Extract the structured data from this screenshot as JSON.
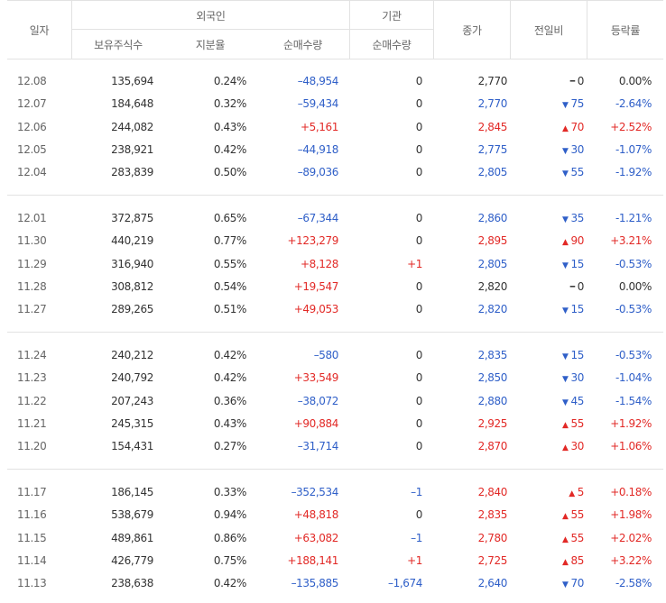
{
  "header": {
    "date": "일자",
    "foreign": "외국인",
    "holdings": "보유주식수",
    "ratio": "지분율",
    "foreign_net": "순매수량",
    "institution": "기관",
    "inst_net": "순매수량",
    "close": "종가",
    "diff": "전일비",
    "rate": "등락률"
  },
  "colors": {
    "up": "#e22926",
    "down": "#2f5fc8",
    "flat": "#333333"
  },
  "groups": [
    {
      "rows": [
        {
          "date": "12.08",
          "holdings": "135,694",
          "ratio": "0.24%",
          "foreign_net": "–48,954",
          "fdir": "down",
          "inst_net": "0",
          "idir": "flat",
          "close": "2,770",
          "cdir": "flat",
          "diff": "0",
          "ddir": "flat",
          "rate": "0.00%"
        },
        {
          "date": "12.07",
          "holdings": "184,648",
          "ratio": "0.32%",
          "foreign_net": "–59,434",
          "fdir": "down",
          "inst_net": "0",
          "idir": "flat",
          "close": "2,770",
          "cdir": "down",
          "diff": "75",
          "ddir": "down",
          "rate": "-2.64%"
        },
        {
          "date": "12.06",
          "holdings": "244,082",
          "ratio": "0.43%",
          "foreign_net": "+5,161",
          "fdir": "up",
          "inst_net": "0",
          "idir": "flat",
          "close": "2,845",
          "cdir": "up",
          "diff": "70",
          "ddir": "up",
          "rate": "+2.52%"
        },
        {
          "date": "12.05",
          "holdings": "238,921",
          "ratio": "0.42%",
          "foreign_net": "–44,918",
          "fdir": "down",
          "inst_net": "0",
          "idir": "flat",
          "close": "2,775",
          "cdir": "down",
          "diff": "30",
          "ddir": "down",
          "rate": "-1.07%"
        },
        {
          "date": "12.04",
          "holdings": "283,839",
          "ratio": "0.50%",
          "foreign_net": "–89,036",
          "fdir": "down",
          "inst_net": "0",
          "idir": "flat",
          "close": "2,805",
          "cdir": "down",
          "diff": "55",
          "ddir": "down",
          "rate": "-1.92%"
        }
      ]
    },
    {
      "rows": [
        {
          "date": "12.01",
          "holdings": "372,875",
          "ratio": "0.65%",
          "foreign_net": "–67,344",
          "fdir": "down",
          "inst_net": "0",
          "idir": "flat",
          "close": "2,860",
          "cdir": "down",
          "diff": "35",
          "ddir": "down",
          "rate": "-1.21%"
        },
        {
          "date": "11.30",
          "holdings": "440,219",
          "ratio": "0.77%",
          "foreign_net": "+123,279",
          "fdir": "up",
          "inst_net": "0",
          "idir": "flat",
          "close": "2,895",
          "cdir": "up",
          "diff": "90",
          "ddir": "up",
          "rate": "+3.21%"
        },
        {
          "date": "11.29",
          "holdings": "316,940",
          "ratio": "0.55%",
          "foreign_net": "+8,128",
          "fdir": "up",
          "inst_net": "+1",
          "idir": "up",
          "close": "2,805",
          "cdir": "down",
          "diff": "15",
          "ddir": "down",
          "rate": "-0.53%"
        },
        {
          "date": "11.28",
          "holdings": "308,812",
          "ratio": "0.54%",
          "foreign_net": "+19,547",
          "fdir": "up",
          "inst_net": "0",
          "idir": "flat",
          "close": "2,820",
          "cdir": "flat",
          "diff": "0",
          "ddir": "flat",
          "rate": "0.00%"
        },
        {
          "date": "11.27",
          "holdings": "289,265",
          "ratio": "0.51%",
          "foreign_net": "+49,053",
          "fdir": "up",
          "inst_net": "0",
          "idir": "flat",
          "close": "2,820",
          "cdir": "down",
          "diff": "15",
          "ddir": "down",
          "rate": "-0.53%"
        }
      ]
    },
    {
      "rows": [
        {
          "date": "11.24",
          "holdings": "240,212",
          "ratio": "0.42%",
          "foreign_net": "–580",
          "fdir": "down",
          "inst_net": "0",
          "idir": "flat",
          "close": "2,835",
          "cdir": "down",
          "diff": "15",
          "ddir": "down",
          "rate": "-0.53%"
        },
        {
          "date": "11.23",
          "holdings": "240,792",
          "ratio": "0.42%",
          "foreign_net": "+33,549",
          "fdir": "up",
          "inst_net": "0",
          "idir": "flat",
          "close": "2,850",
          "cdir": "down",
          "diff": "30",
          "ddir": "down",
          "rate": "-1.04%"
        },
        {
          "date": "11.22",
          "holdings": "207,243",
          "ratio": "0.36%",
          "foreign_net": "–38,072",
          "fdir": "down",
          "inst_net": "0",
          "idir": "flat",
          "close": "2,880",
          "cdir": "down",
          "diff": "45",
          "ddir": "down",
          "rate": "-1.54%"
        },
        {
          "date": "11.21",
          "holdings": "245,315",
          "ratio": "0.43%",
          "foreign_net": "+90,884",
          "fdir": "up",
          "inst_net": "0",
          "idir": "flat",
          "close": "2,925",
          "cdir": "up",
          "diff": "55",
          "ddir": "up",
          "rate": "+1.92%"
        },
        {
          "date": "11.20",
          "holdings": "154,431",
          "ratio": "0.27%",
          "foreign_net": "–31,714",
          "fdir": "down",
          "inst_net": "0",
          "idir": "flat",
          "close": "2,870",
          "cdir": "up",
          "diff": "30",
          "ddir": "up",
          "rate": "+1.06%"
        }
      ]
    },
    {
      "rows": [
        {
          "date": "11.17",
          "holdings": "186,145",
          "ratio": "0.33%",
          "foreign_net": "–352,534",
          "fdir": "down",
          "inst_net": "–1",
          "idir": "down",
          "close": "2,840",
          "cdir": "up",
          "diff": "5",
          "ddir": "up",
          "rate": "+0.18%"
        },
        {
          "date": "11.16",
          "holdings": "538,679",
          "ratio": "0.94%",
          "foreign_net": "+48,818",
          "fdir": "up",
          "inst_net": "0",
          "idir": "flat",
          "close": "2,835",
          "cdir": "up",
          "diff": "55",
          "ddir": "up",
          "rate": "+1.98%"
        },
        {
          "date": "11.15",
          "holdings": "489,861",
          "ratio": "0.86%",
          "foreign_net": "+63,082",
          "fdir": "up",
          "inst_net": "–1",
          "idir": "down",
          "close": "2,780",
          "cdir": "up",
          "diff": "55",
          "ddir": "up",
          "rate": "+2.02%"
        },
        {
          "date": "11.14",
          "holdings": "426,779",
          "ratio": "0.75%",
          "foreign_net": "+188,141",
          "fdir": "up",
          "inst_net": "+1",
          "idir": "up",
          "close": "2,725",
          "cdir": "up",
          "diff": "85",
          "ddir": "up",
          "rate": "+3.22%"
        },
        {
          "date": "11.13",
          "holdings": "238,638",
          "ratio": "0.42%",
          "foreign_net": "–135,885",
          "fdir": "down",
          "inst_net": "–1,674",
          "idir": "down",
          "close": "2,640",
          "cdir": "down",
          "diff": "70",
          "ddir": "down",
          "rate": "-2.58%"
        }
      ]
    }
  ]
}
